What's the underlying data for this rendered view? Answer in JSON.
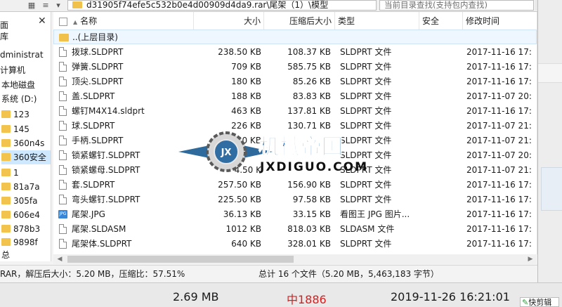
{
  "address": {
    "path": "d31905f74efe5c532b0e4d00909d4da9.rar\\尾架（1）\\模型"
  },
  "search": {
    "placeholder": "当前目录查找(支持包内查找)"
  },
  "tree": {
    "items": [
      {
        "label": "面"
      },
      {
        "label": "库"
      },
      {
        "label": "dministrat"
      },
      {
        "label": "计算机"
      },
      {
        "label": "本地磁盘"
      },
      {
        "label": "系统 (D:)"
      },
      {
        "label": "123"
      },
      {
        "label": "145"
      },
      {
        "label": "360n4s"
      },
      {
        "label": "360安全"
      },
      {
        "label": "1"
      },
      {
        "label": "81a7a"
      },
      {
        "label": "305fa"
      },
      {
        "label": "606e4"
      },
      {
        "label": "878b3"
      },
      {
        "label": "9898f"
      },
      {
        "label": "总"
      }
    ]
  },
  "columns": {
    "name": "名称",
    "size": "大小",
    "packed": "压缩后大小",
    "type": "类型",
    "security": "安全",
    "modified": "修改时间"
  },
  "updir": "..(上层目录)",
  "files": [
    {
      "name": "拨球.SLDPRT",
      "size": "238.50 KB",
      "packed": "108.37 KB",
      "type": "SLDPRT 文件",
      "modified": "2017-11-16 17:",
      "icon": "file"
    },
    {
      "name": "弹簧.SLDPRT",
      "size": "709 KB",
      "packed": "585.75 KB",
      "type": "SLDPRT 文件",
      "modified": "2017-11-16 17:",
      "icon": "file"
    },
    {
      "name": "顶尖.SLDPRT",
      "size": "180 KB",
      "packed": "85.26 KB",
      "type": "SLDPRT 文件",
      "modified": "2017-11-16 17:",
      "icon": "file"
    },
    {
      "name": "盖.SLDPRT",
      "size": "188 KB",
      "packed": "83.83 KB",
      "type": "SLDPRT 文件",
      "modified": "2017-11-07 20:",
      "icon": "file"
    },
    {
      "name": "螺钉M4X14.sldprt",
      "size": "463 KB",
      "packed": "137.81 KB",
      "type": "SLDPRT 文件",
      "modified": "2017-11-16 17:",
      "icon": "file"
    },
    {
      "name": "球.SLDPRT",
      "size": "226 KB",
      "packed": "130.71 KB",
      "type": "SLDPRT 文件",
      "modified": "2017-11-07 21:",
      "icon": "file"
    },
    {
      "name": "手柄.SLDPRT",
      "size": "50 KB",
      "packed": "",
      "type": "SLDPRT 文件",
      "modified": "2017-11-07 21:",
      "icon": "file"
    },
    {
      "name": "锁紧螺钉.SLDPRT",
      "size": "",
      "packed": "",
      "type": "SLDPRT 文件",
      "modified": "2017-11-07 20:",
      "icon": "file"
    },
    {
      "name": "锁紧螺母.SLDPRT",
      "size": "4.50 K",
      "packed": "",
      "type": "SLDPRT 文件",
      "modified": "2017-11-07 21:",
      "icon": "file"
    },
    {
      "name": "套.SLDPRT",
      "size": "257.50 KB",
      "packed": "156.90 KB",
      "type": "SLDPRT 文件",
      "modified": "2017-11-16 17:",
      "icon": "file"
    },
    {
      "name": "弯头螺钉.SLDPRT",
      "size": "225.50 KB",
      "packed": "97.58 KB",
      "type": "SLDPRT 文件",
      "modified": "2017-11-16 17:",
      "icon": "file"
    },
    {
      "name": "尾架.JPG",
      "size": "36.13 KB",
      "packed": "33.15 KB",
      "type": "看图王 JPG 图片...",
      "modified": "2017-11-16 17:",
      "icon": "jpg"
    },
    {
      "name": "尾架.SLDASM",
      "size": "1012 KB",
      "packed": "818.03 KB",
      "type": "SLDASM 文件",
      "modified": "2017-11-16 17:",
      "icon": "file"
    },
    {
      "name": "尾架体.SLDPRT",
      "size": "640 KB",
      "packed": "328.01 KB",
      "type": "SLDPRT 文件",
      "modified": "2017-11-16 17:",
      "icon": "file"
    }
  ],
  "status": {
    "left": "RAR，解压后大小：5.20 MB，压缩比：57.51%",
    "right": "总计 16 个文件（5.20 MB，5,463,183 字节）"
  },
  "watermark": {
    "title": "机械帝国",
    "domain": "JXDIGUO.COM",
    "badge": "JX"
  },
  "background": {
    "size_text": "2.69 MB",
    "red_text": "中1886",
    "date_text": "2019-11-26 16:21:01",
    "button_label": "快剪辑"
  }
}
